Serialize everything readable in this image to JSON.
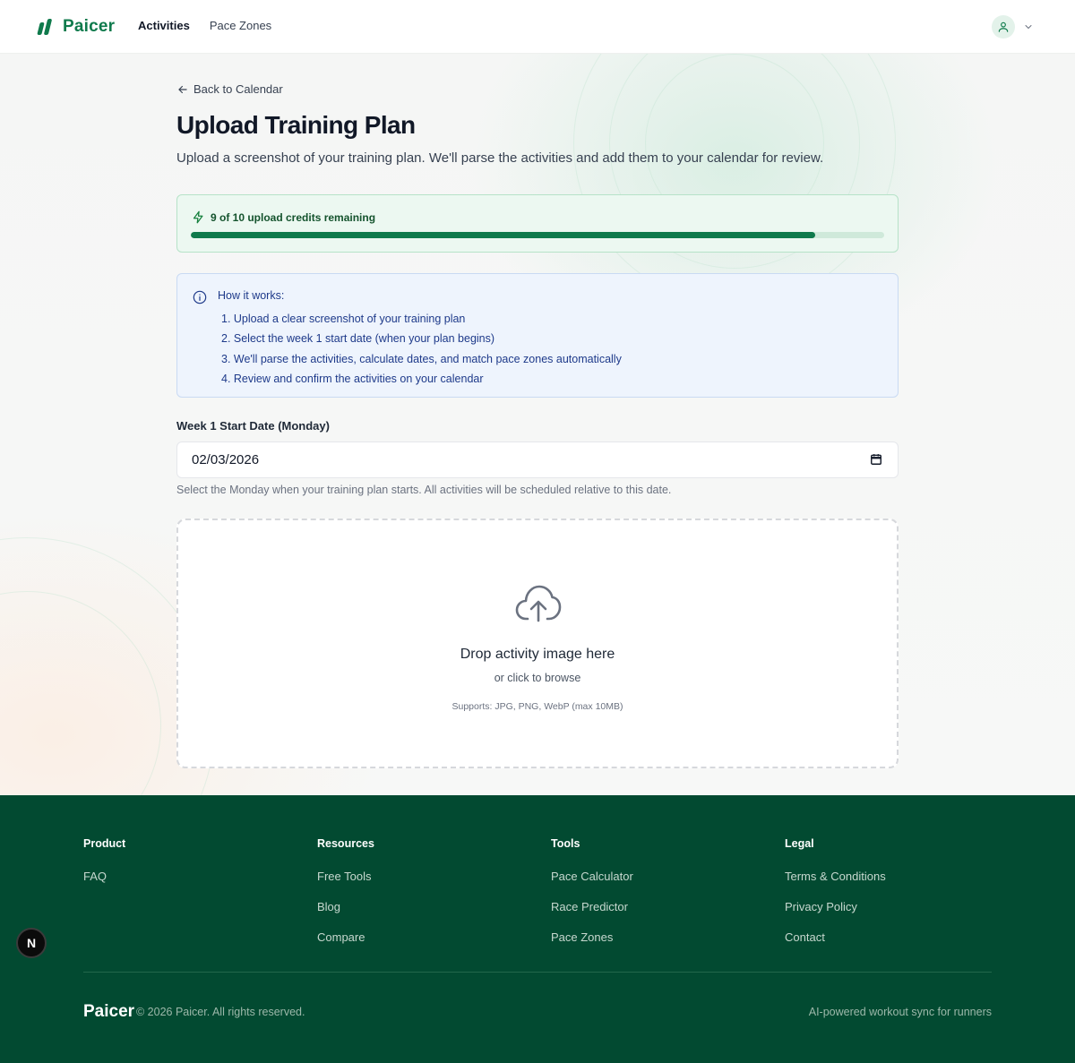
{
  "header": {
    "brand": "Paicer",
    "nav": [
      {
        "label": "Activities",
        "active": true
      },
      {
        "label": "Pace Zones",
        "active": false
      }
    ]
  },
  "page": {
    "back_label": "Back to Calendar",
    "title": "Upload Training Plan",
    "subtitle": "Upload a screenshot of your training plan. We'll parse the activities and add them to your calendar for review."
  },
  "credits": {
    "label": "9 of 10 upload credits remaining",
    "used": 1,
    "total": 10,
    "remaining_fraction": 0.9,
    "accent": "#0f7a4c"
  },
  "howto": {
    "title": "How it works:",
    "steps": [
      "1. Upload a clear screenshot of your training plan",
      "2. Select the week 1 start date (when your plan begins)",
      "3. We'll parse the activities, calculate dates, and match pace zones automatically",
      "4. Review and confirm the activities on your calendar"
    ]
  },
  "start_date": {
    "label": "Week 1 Start Date (Monday)",
    "value": "02/03/2026",
    "help": "Select the Monday when your training plan starts. All activities will be scheduled relative to this date."
  },
  "dropzone": {
    "title": "Drop activity image here",
    "subtitle": "or click to browse",
    "support": "Supports: JPG, PNG, WebP (max 10MB)",
    "icon": "cloud-upload-icon"
  },
  "footer": {
    "columns": [
      {
        "heading": "Product",
        "links": [
          "FAQ"
        ]
      },
      {
        "heading": "Resources",
        "links": [
          "Free Tools",
          "Blog",
          "Compare"
        ]
      },
      {
        "heading": "Tools",
        "links": [
          "Pace Calculator",
          "Race Predictor",
          "Pace Zones"
        ]
      },
      {
        "heading": "Legal",
        "links": [
          "Terms & Conditions",
          "Privacy Policy",
          "Contact"
        ]
      }
    ],
    "brand": "Paicer",
    "copyright": "© 2026 Paicer. All rights reserved.",
    "tagline": "AI-powered workout sync for runners",
    "background": "#024a31"
  },
  "dev_badge": {
    "letter": "N"
  }
}
